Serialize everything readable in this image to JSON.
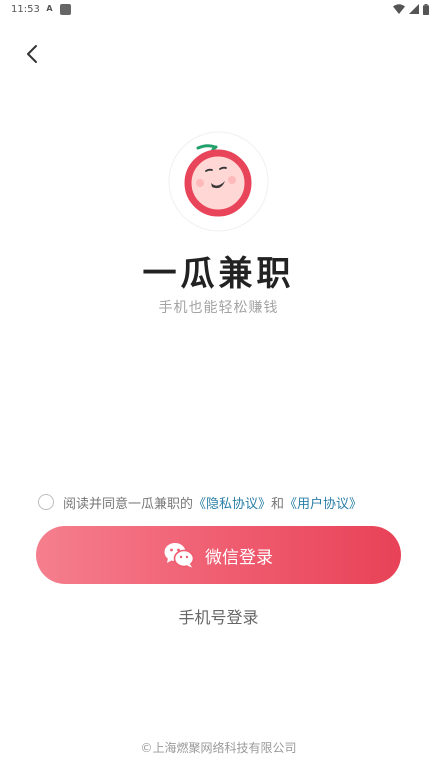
{
  "status_bar": {
    "time": "11:53",
    "notification_icon": "A",
    "icons": [
      "wifi-icon",
      "cellular-signal-icon",
      "battery-icon"
    ]
  },
  "header": {
    "back_icon": "chevron-left-icon"
  },
  "brand": {
    "app_name": "一瓜兼职",
    "slogan": "手机也能轻松赚钱",
    "logo_icon": "smiling-fruit-logo-icon",
    "logo_red": "#e9455a",
    "logo_green": "#22a06b"
  },
  "agreement": {
    "prefix": "阅读并同意一瓜兼职的",
    "privacy_link": "《隐私协议》",
    "and": "和",
    "user_link": "《用户协议》",
    "link_color": "#2b7fa8",
    "checked": false
  },
  "login": {
    "wechat_label": "微信登录",
    "phone_label": "手机号登录",
    "accent_start": "#f57f8e",
    "accent_end": "#e84257"
  },
  "footer": {
    "copyright": "©上海燃聚网络科技有限公司"
  }
}
